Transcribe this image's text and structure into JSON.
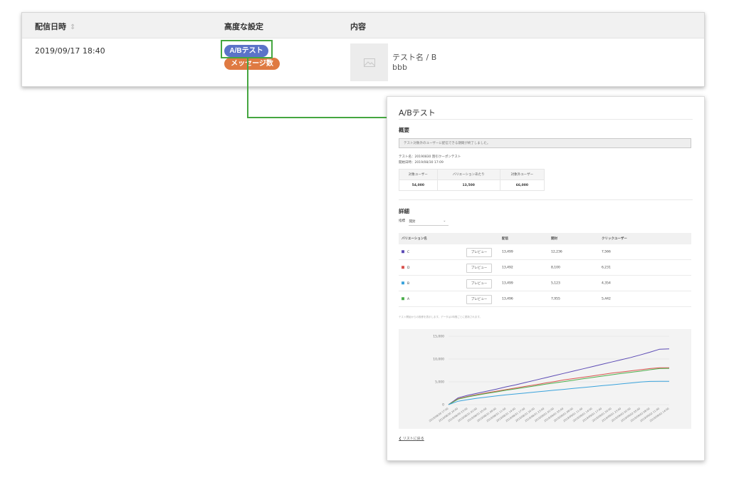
{
  "list": {
    "headers": {
      "date": "配信日時",
      "date_sort_icon": "sort-icon",
      "advanced": "高度な設定",
      "content": "内容"
    },
    "sort_glyph": "⇕",
    "row": {
      "date": "2019/09/17 18:40",
      "tag_ab": "A/Bテスト",
      "tag_msg": "メッセージ数",
      "content_title": "テスト名 / B",
      "content_sub": "bbb",
      "thumb_icon": "image-placeholder-icon"
    },
    "colors": {
      "tag_ab": "#5b73c8",
      "tag_msg": "#df7a42",
      "highlight": "#45a640"
    }
  },
  "panel": {
    "title": "A/Bテスト",
    "summary_heading": "概要",
    "notice": "テスト対象外のユーザーに配信できる期間が終了しました。",
    "meta_name_label": "テスト名：",
    "meta_name": "20190830 割引クーポンテスト",
    "meta_start_label": "開始日時：",
    "meta_start": "2019/08/30 17:09",
    "summary_table": {
      "headers": [
        "対象ユーザー",
        "バリエーションあたり",
        "対象外ユーザー"
      ],
      "values": [
        "54,000",
        "13,500",
        "66,000"
      ]
    },
    "detail_heading": "詳細",
    "metric_label": "指標",
    "metric_value": "開封",
    "metric_caret": "⌄",
    "variations_table": {
      "headers": [
        "バリエーション名",
        "配信",
        "開封",
        "クリックユーザー"
      ],
      "preview_label": "プレビュー",
      "rows": [
        {
          "name": "C",
          "color": "#5c4bb5",
          "sent": "13,499",
          "opened": "12,236",
          "clicks": "7,566"
        },
        {
          "name": "D",
          "color": "#d9534f",
          "sent": "13,492",
          "opened": "8,100",
          "clicks": "6,231"
        },
        {
          "name": "B",
          "color": "#3aa3dc",
          "sent": "13,499",
          "opened": "5,123",
          "clicks": "4,354"
        },
        {
          "name": "A",
          "color": "#4cae4c",
          "sent": "13,496",
          "opened": "7,955",
          "clicks": "5,442"
        }
      ]
    },
    "footnote": "テスト開始からの推移を表示します。データは1時間ごとに更新されます。",
    "back_link": "❮ リストに戻る"
  },
  "chart_data": {
    "type": "line",
    "ylim": [
      0,
      15000
    ],
    "yticks": [
      "0",
      "5,000",
      "10,000",
      "15,000"
    ],
    "x": [
      "2019/08/30 17:00",
      "2019/08/30 20:00",
      "2019/08/30 23:00",
      "2019/08/31 02:00",
      "2019/08/31 05:00",
      "2019/08/31 08:00",
      "2019/08/31 11:00",
      "2019/08/31 14:00",
      "2019/08/31 17:00",
      "2019/08/31 20:00",
      "2019/08/31 23:00",
      "2019/09/01 02:00",
      "2019/09/01 05:00",
      "2019/09/01 08:00",
      "2019/09/01 11:00",
      "2019/09/01 14:00",
      "2019/09/01 17:00",
      "2019/09/01 20:00",
      "2019/09/01 23:00",
      "2019/09/02 02:00",
      "2019/09/02 05:00",
      "2019/09/02 08:00",
      "2019/09/02 11:00",
      "2019/09/02 14:00"
    ],
    "series": [
      {
        "name": "C",
        "color": "#5c4bb5",
        "values": [
          0,
          1500,
          2050,
          2500,
          2950,
          3400,
          3900,
          4350,
          4850,
          5350,
          5850,
          6350,
          6850,
          7350,
          7850,
          8350,
          8850,
          9350,
          9850,
          10350,
          10900,
          11500,
          12150,
          12236
        ]
      },
      {
        "name": "D",
        "color": "#d9534f",
        "values": [
          0,
          1300,
          1800,
          2200,
          2600,
          2950,
          3300,
          3650,
          4000,
          4350,
          4700,
          5050,
          5400,
          5700,
          6000,
          6300,
          6600,
          6900,
          7150,
          7400,
          7650,
          7900,
          8100,
          8100
        ]
      },
      {
        "name": "A",
        "color": "#4cae4c",
        "values": [
          0,
          1200,
          1700,
          2100,
          2450,
          2800,
          3150,
          3450,
          3800,
          4100,
          4450,
          4750,
          5050,
          5350,
          5650,
          5950,
          6250,
          6550,
          6850,
          7100,
          7350,
          7650,
          7900,
          7955
        ]
      },
      {
        "name": "B",
        "color": "#3aa3dc",
        "values": [
          0,
          750,
          1100,
          1400,
          1650,
          1900,
          2150,
          2350,
          2550,
          2750,
          2950,
          3150,
          3350,
          3550,
          3750,
          3950,
          4150,
          4350,
          4550,
          4750,
          4950,
          5100,
          5120,
          5123
        ]
      }
    ]
  }
}
